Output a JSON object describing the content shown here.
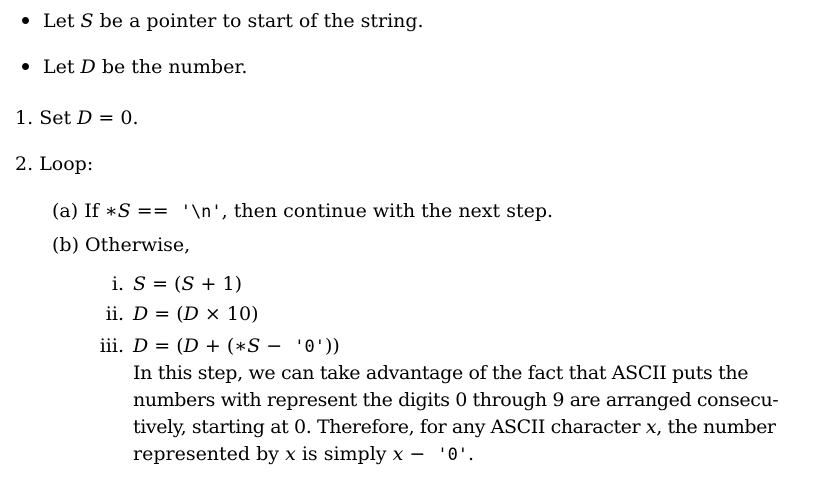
{
  "bullets": [
    {
      "pre": "Let ",
      "var": "S",
      "post": " be a pointer to start of the string."
    },
    {
      "pre": "Let ",
      "var": "D",
      "post": " be the number."
    }
  ],
  "steps": [
    {
      "label": "1.",
      "pre": "Set ",
      "var": "D",
      "post": " = 0."
    },
    {
      "label": "2.",
      "text": "Loop:"
    }
  ],
  "substeps": {
    "a": {
      "label": "(a)",
      "pre": "If ∗",
      "var": "S",
      "op": " == ",
      "code": "'\\n'",
      "post": ", then continue with the next step."
    },
    "b": {
      "label": "(b)",
      "text": "Otherwise,"
    }
  },
  "subsubsteps": [
    {
      "label": "i.",
      "v1": "S",
      "mid": " = (",
      "v2": "S",
      "end": " + 1)"
    },
    {
      "label": "ii.",
      "v1": "D",
      "mid": " = (",
      "v2": "D",
      "end": " × 10)"
    },
    {
      "label": "iii.",
      "v1": "D",
      "mid": " = (",
      "v2": "D",
      "end": " + (∗",
      "v3": "S",
      "minus": " − ",
      "code": "'0'",
      "close": "))"
    }
  ],
  "explanation": {
    "line1": "In this step, we can take advantage of the fact that ASCII puts the",
    "line2": "numbers with represent the digits 0 through 9 are arranged consecu-",
    "line3_pre": "tively, starting at 0. Therefore, for any ASCII character ",
    "line3_var": "x",
    "line3_post": ", the number",
    "line4_pre": "represented by ",
    "line4_var": "x",
    "line4_mid": " is simply ",
    "line4_var2": "x",
    "line4_minus": " − ",
    "line4_code": "'0'",
    "line4_end": "."
  }
}
